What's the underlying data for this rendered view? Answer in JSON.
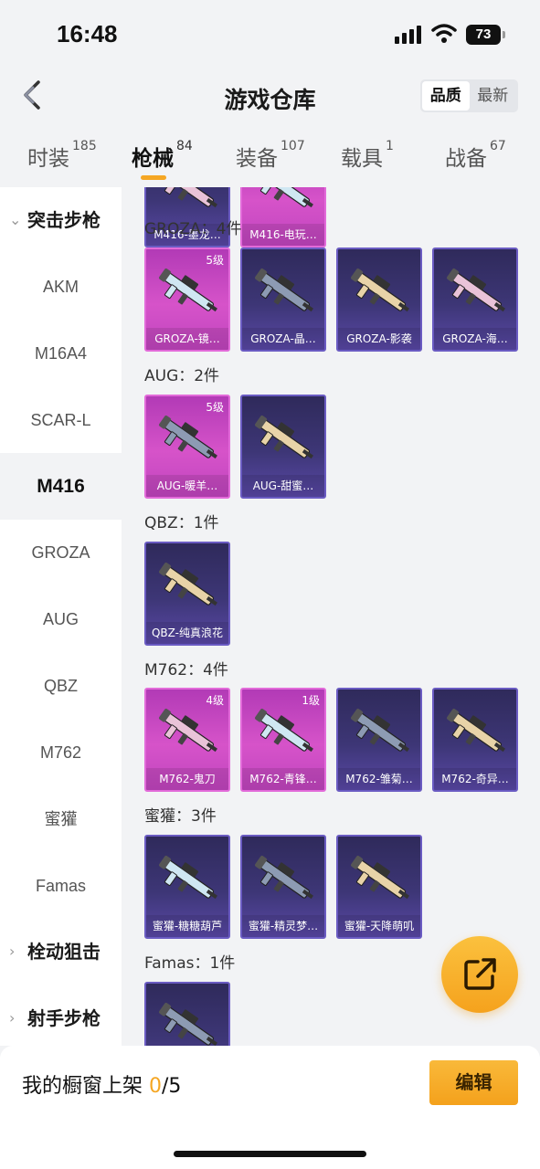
{
  "status_bar": {
    "time": "16:48",
    "battery": "73"
  },
  "header": {
    "title": "游戏仓库",
    "sort_options": [
      "品质",
      "最新"
    ],
    "sort_selected": "品质"
  },
  "tabs": [
    {
      "label": "时装",
      "count": "185"
    },
    {
      "label": "枪械",
      "count": "84"
    },
    {
      "label": "装备",
      "count": "107"
    },
    {
      "label": "载具",
      "count": "1"
    },
    {
      "label": "战备",
      "count": "67"
    }
  ],
  "active_tab": "枪械",
  "sidebar": {
    "groups": [
      "突击步枪",
      "栓动狙击",
      "射手步枪"
    ],
    "items": [
      "AKM",
      "M16A4",
      "SCAR-L",
      "M416",
      "GROZA",
      "AUG",
      "QBZ",
      "M762",
      "蜜獾",
      "Famas"
    ],
    "active_item": "M416"
  },
  "sections": [
    {
      "title": "",
      "cards": [
        {
          "name": "M416-墨龙…",
          "level": "",
          "rarity": "blue"
        },
        {
          "name": "M416-电玩…",
          "level": "",
          "rarity": "purple"
        }
      ]
    },
    {
      "title": "GROZA：4件",
      "cards": [
        {
          "name": "GROZA-镜…",
          "level": "5级",
          "rarity": "purple"
        },
        {
          "name": "GROZA-晶…",
          "level": "",
          "rarity": "blue"
        },
        {
          "name": "GROZA-影袭",
          "level": "",
          "rarity": "blue"
        },
        {
          "name": "GROZA-海…",
          "level": "",
          "rarity": "blue"
        }
      ]
    },
    {
      "title": "AUG：2件",
      "cards": [
        {
          "name": "AUG-暖羊…",
          "level": "5级",
          "rarity": "purple"
        },
        {
          "name": "AUG-甜蜜…",
          "level": "",
          "rarity": "blue"
        }
      ]
    },
    {
      "title": "QBZ：1件",
      "cards": [
        {
          "name": "QBZ-纯真浪花",
          "level": "",
          "rarity": "blue"
        }
      ]
    },
    {
      "title": "M762：4件",
      "cards": [
        {
          "name": "M762-鬼刀",
          "level": "4级",
          "rarity": "purple"
        },
        {
          "name": "M762-青锋…",
          "level": "1级",
          "rarity": "purple"
        },
        {
          "name": "M762-雏菊…",
          "level": "",
          "rarity": "blue"
        },
        {
          "name": "M762-奇异…",
          "level": "",
          "rarity": "blue"
        }
      ]
    },
    {
      "title": "蜜獾：3件",
      "cards": [
        {
          "name": "蜜獾-糖糖葫芦",
          "level": "",
          "rarity": "blue"
        },
        {
          "name": "蜜獾-精灵梦…",
          "level": "",
          "rarity": "blue"
        },
        {
          "name": "蜜獾-天降萌叽",
          "level": "",
          "rarity": "blue"
        }
      ]
    },
    {
      "title": "Famas：1件",
      "cards": [
        {
          "name": "",
          "level": "",
          "rarity": "blue"
        }
      ]
    }
  ],
  "bottom": {
    "label": "我的橱窗上架",
    "current": "0",
    "total": "/5",
    "edit_label": "编辑"
  },
  "colors": {
    "accent": "#f5a623",
    "purple_card": "#c145bf",
    "blue_card": "#3d3676"
  },
  "icons": [
    "back-arrow-icon",
    "share-icon",
    "signal-icon",
    "wifi-icon",
    "battery-icon",
    "gun-icon",
    "chevron-down-icon",
    "chevron-right-icon"
  ]
}
